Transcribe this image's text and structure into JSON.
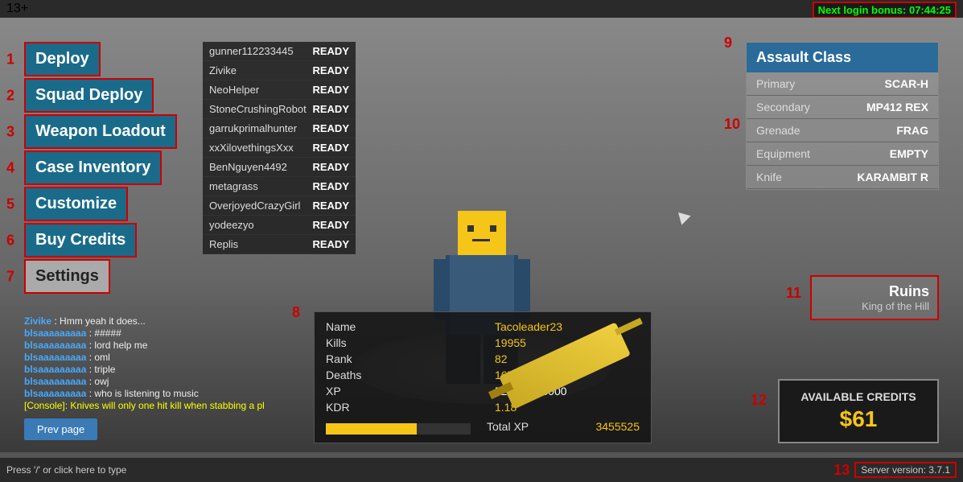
{
  "topbar": {
    "age_label": "13+",
    "login_bonus": "Next login bonus: 07:44:25"
  },
  "sidebar": {
    "items": [
      {
        "id": "deploy",
        "label": "Deploy",
        "num": "1"
      },
      {
        "id": "squad-deploy",
        "label": "Squad Deploy",
        "num": "2"
      },
      {
        "id": "weapon-loadout",
        "label": "Weapon Loadout",
        "num": "3"
      },
      {
        "id": "case-inventory",
        "label": "Case Inventory",
        "num": "4"
      },
      {
        "id": "customize",
        "label": "Customize",
        "num": "5"
      },
      {
        "id": "buy-credits",
        "label": "Buy Credits",
        "num": "6"
      },
      {
        "id": "settings",
        "label": "Settings",
        "num": "7"
      }
    ]
  },
  "players": [
    {
      "name": "gunner112233445",
      "status": "READY"
    },
    {
      "name": "Zivike",
      "status": "READY"
    },
    {
      "name": "NeoHelper",
      "status": "READY"
    },
    {
      "name": "StoneCrushingRobot",
      "status": "READY"
    },
    {
      "name": "garrukprimalhunter",
      "status": "READY"
    },
    {
      "name": "xxXilovethingsXxx",
      "status": "READY"
    },
    {
      "name": "BenNguyen4492",
      "status": "READY"
    },
    {
      "name": "metagrass",
      "status": "READY"
    },
    {
      "name": "OverjoyedCrazyGirl",
      "status": "READY"
    },
    {
      "name": "yodeezyo",
      "status": "READY"
    },
    {
      "name": "Replis",
      "status": "READY"
    }
  ],
  "chat": [
    {
      "name": "Zivike",
      "separator": " : ",
      "msg": "Hmm yeah it does..."
    },
    {
      "name": "blsaaaaaaaaa",
      "separator": " : ",
      "msg": "#####"
    },
    {
      "name": "blsaaaaaaaaa",
      "separator": " : ",
      "msg": "lord help me"
    },
    {
      "name": "blsaaaaaaaaa",
      "separator": " : ",
      "msg": "oml"
    },
    {
      "name": "blsaaaaaaaaa",
      "separator": " : ",
      "msg": "triple"
    },
    {
      "name": "blsaaaaaaaaa",
      "separator": " : ",
      "msg": "owj"
    },
    {
      "name": "blsaaaaaaaaa",
      "separator": " : ",
      "msg": "who is listening to music"
    },
    {
      "name": "[Console]",
      "separator": ": ",
      "msg": "Knives will only one hit kill when stabbing a pl",
      "is_console": true
    }
  ],
  "prev_page_btn": "Prev page",
  "stats": {
    "name_label": "Name",
    "name_value": "Tacoleader23",
    "rank_label": "Rank",
    "rank_value": "82",
    "xp_label": "XP",
    "xp_value": "52525 / 83000",
    "xp_percent": 63,
    "kills_label": "Kills",
    "kills_value": "19955",
    "deaths_label": "Deaths",
    "deaths_value": "16777",
    "kdr_label": "KDR",
    "kdr_value": "1.18",
    "total_xp_label": "Total XP",
    "total_xp_value": "3455525"
  },
  "assault_class": {
    "title": "Assault Class",
    "rows": [
      {
        "label": "Primary",
        "value": "SCAR-H"
      },
      {
        "label": "Secondary",
        "value": "MP412 REX"
      },
      {
        "label": "Grenade",
        "value": "FRAG"
      },
      {
        "label": "Equipment",
        "value": "EMPTY"
      },
      {
        "label": "Knife",
        "value": "KARAMBIT R"
      }
    ]
  },
  "map": {
    "name": "Ruins",
    "mode": "King of the Hill"
  },
  "credits": {
    "label": "AVAILABLE CREDITS",
    "amount": "$61"
  },
  "bottom_bar": {
    "hint": "Press '/' or click here to type",
    "server_version": "Server version: 3.7.1"
  },
  "annotations": {
    "n1": "1",
    "n2": "2",
    "n3": "3",
    "n4": "4",
    "n5": "5",
    "n6": "6",
    "n7": "7",
    "n8": "8",
    "n9": "9",
    "n10": "10",
    "n11": "11",
    "n12": "12",
    "n13": "13"
  }
}
